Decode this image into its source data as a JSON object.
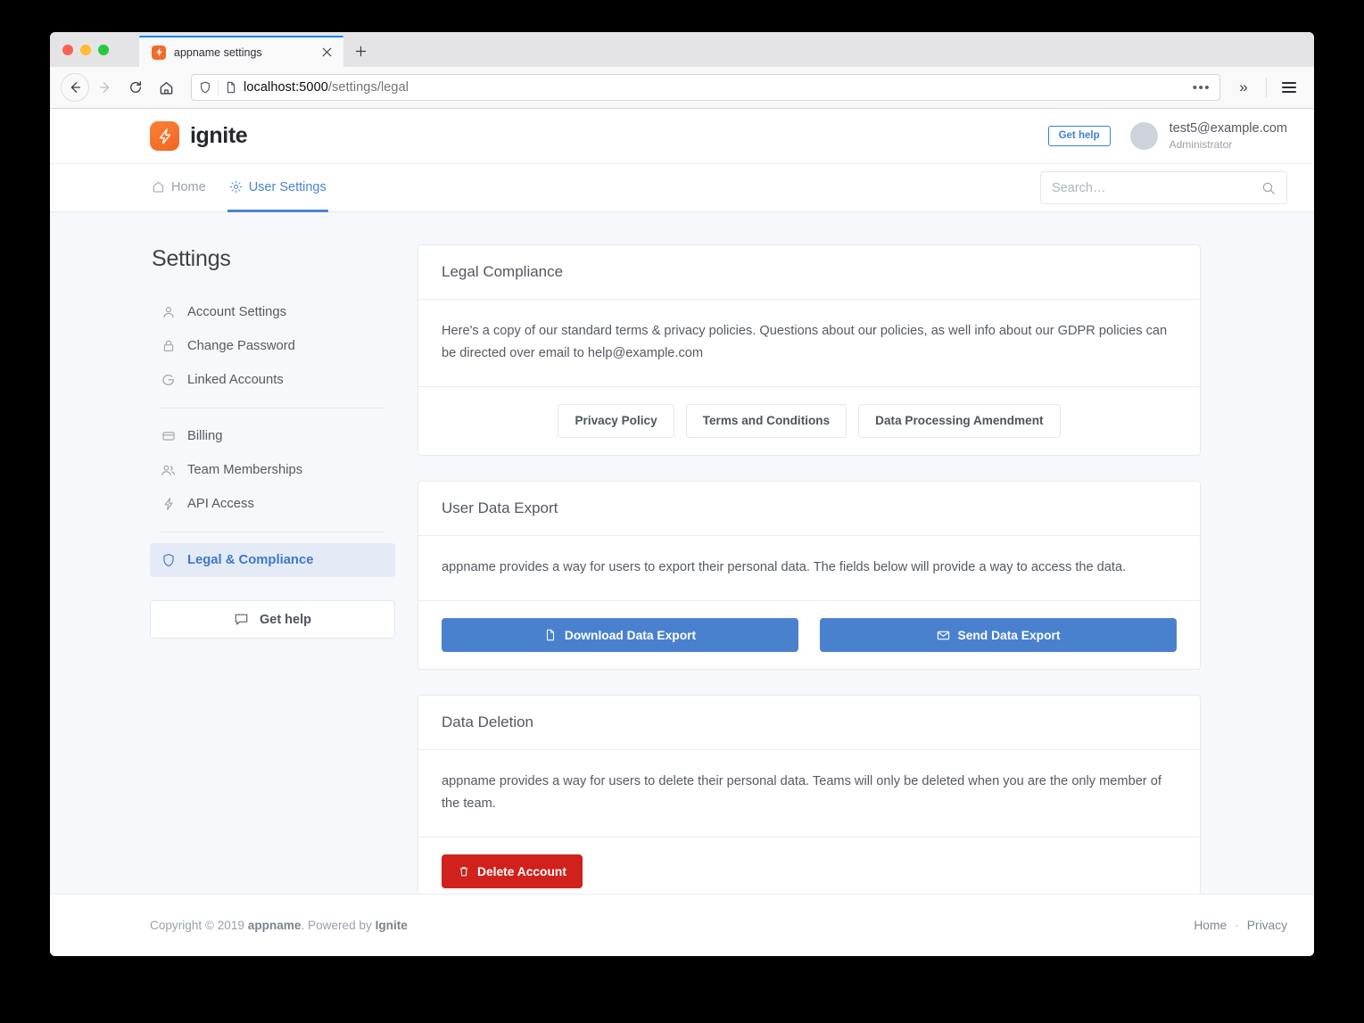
{
  "browser": {
    "tab_title": "appname settings",
    "favicon": "ignite-bolt-icon",
    "new_tab_label": "+",
    "close_label": "×",
    "url_host": "localhost:5000",
    "url_path": "/settings/legal",
    "url_overflow": "•••",
    "overflow_chevrons": "»"
  },
  "header": {
    "brand_name": "ignite",
    "get_help_label": "Get help",
    "user_email": "test5@example.com",
    "user_role": "Administrator"
  },
  "nav": {
    "tabs": [
      {
        "label": "Home",
        "icon": "home-icon",
        "active": false
      },
      {
        "label": "User Settings",
        "icon": "gear-icon",
        "active": true
      }
    ],
    "search_placeholder": "Search…",
    "search_value": ""
  },
  "sidebar": {
    "title": "Settings",
    "group1": [
      {
        "label": "Account Settings",
        "icon": "person-icon"
      },
      {
        "label": "Change Password",
        "icon": "lock-icon"
      },
      {
        "label": "Linked Accounts",
        "icon": "google-g-icon"
      }
    ],
    "group2": [
      {
        "label": "Billing",
        "icon": "credit-card-icon"
      },
      {
        "label": "Team Memberships",
        "icon": "people-icon"
      },
      {
        "label": "API Access",
        "icon": "lightning-icon"
      }
    ],
    "group3": [
      {
        "label": "Legal & Compliance",
        "icon": "shield-icon",
        "active": true
      }
    ],
    "help_label": "Get help",
    "help_icon": "speech-bubble-icon"
  },
  "cards": [
    {
      "title": "Legal Compliance",
      "body": "Here's a copy of our standard terms & privacy policies. Questions about our policies, as well info about our GDPR policies can be directed over email to help@example.com",
      "buttons": [
        {
          "label": "Privacy Policy"
        },
        {
          "label": "Terms and Conditions"
        },
        {
          "label": "Data Processing Amendment"
        }
      ]
    },
    {
      "title": "User Data Export",
      "body": "appname provides a way for users to export their personal data. The fields below will provide a way to access the data.",
      "buttons": [
        {
          "label": "Download Data Export",
          "icon": "file-icon"
        },
        {
          "label": "Send Data Export",
          "icon": "envelope-icon"
        }
      ]
    },
    {
      "title": "Data Deletion",
      "body": "appname provides a way for users to delete their personal data. Teams will only be deleted when you are the only member of the team.",
      "buttons": [
        {
          "label": "Delete Account",
          "icon": "trash-icon"
        }
      ]
    }
  ],
  "footer": {
    "copyright_prefix": "Copyright © 2019 ",
    "copyright_appname": "appname",
    "copyright_mid": ". Powered by ",
    "copyright_brand": "Ignite",
    "links": [
      "Home",
      "Privacy"
    ],
    "separator": "·"
  },
  "colors": {
    "brand_orange": "#f26522",
    "accent_blue": "#4a81cf",
    "link_blue": "#4077c8",
    "danger_red": "#d0211c",
    "page_bg": "#f6f8fb"
  }
}
